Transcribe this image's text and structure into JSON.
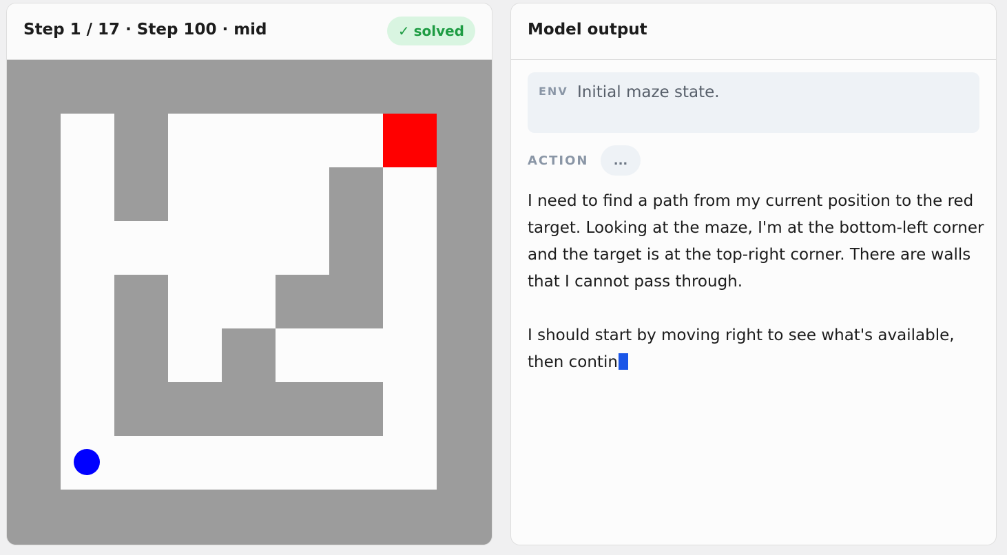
{
  "left_panel": {
    "title": "Step 1 / 17 · Step 100 · mid",
    "status_badge": {
      "icon": "check-icon",
      "glyph": "✓",
      "label": "solved",
      "color": "#1e9c43",
      "background": "#d9f5e1"
    }
  },
  "maze": {
    "rows": 7,
    "cols": 7,
    "grid": [
      "OWO.OOG",
      "OWOO.WO",
      "OOOO.WO",
      "OWO.WWO",
      "OWOWO.O",
      "OWWWWWO",
      "OOOOOOO"
    ],
    "legend": {
      "O": "open",
      "W": "wall",
      "G": "goal",
      ".": "open"
    },
    "player": {
      "row": 6,
      "col": 0
    },
    "colors": {
      "wall": "#9c9c9c",
      "open": "#fcfcfc",
      "goal": "#ff0000",
      "player": "#0000ff"
    }
  },
  "right_panel": {
    "title": "Model output",
    "env": {
      "tag": "ENV",
      "text": "Initial maze state."
    },
    "action": {
      "label": "ACTION",
      "value": "..."
    },
    "output": {
      "paragraph1": "I need to find a path from my current position to the red target. Looking at the maze, I'm at the bottom-left corner and the target is at the top-right corner. There are walls that I cannot pass through.",
      "paragraph2": "I should start by moving right to see what's available, then contin"
    },
    "cursor_color": "#1a56e8"
  }
}
